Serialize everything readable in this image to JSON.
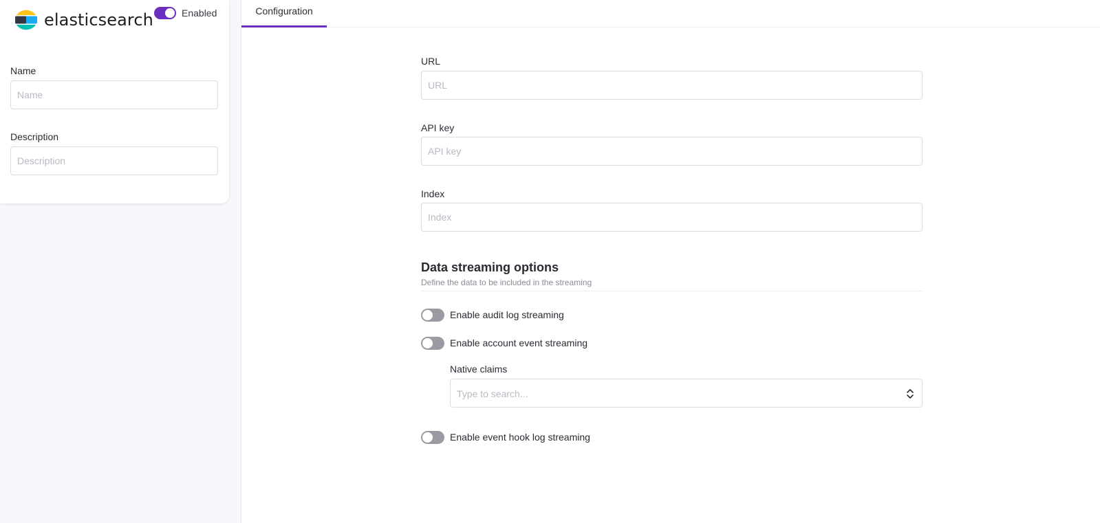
{
  "sidebar": {
    "logo_text": "elasticsearch",
    "enabled_label": "Enabled",
    "enabled": true,
    "name_label": "Name",
    "name_placeholder": "Name",
    "description_label": "Description",
    "description_placeholder": "Description"
  },
  "tabs": [
    {
      "label": "Configuration",
      "active": true
    }
  ],
  "form": {
    "url_label": "URL",
    "url_placeholder": "URL",
    "api_key_label": "API key",
    "api_key_placeholder": "API key",
    "index_label": "Index",
    "index_placeholder": "Index"
  },
  "streaming": {
    "title": "Data streaming options",
    "subtitle": "Define the data to be included in the streaming",
    "audit_label": "Enable audit log streaming",
    "audit_enabled": false,
    "account_label": "Enable account event streaming",
    "account_enabled": false,
    "native_claims_label": "Native claims",
    "native_claims_placeholder": "Type to search...",
    "event_hook_label": "Enable event hook log streaming",
    "event_hook_enabled": false
  },
  "colors": {
    "accent": "#6b2fbf",
    "switch_off": "#9a9aa2",
    "logo_yellow": "#fec514",
    "logo_teal": "#00bfb3",
    "logo_blue": "#1ba9f5",
    "logo_dark": "#343741"
  },
  "icons": [
    "elasticsearch-logo-icon",
    "chevron-up-down-icon"
  ]
}
